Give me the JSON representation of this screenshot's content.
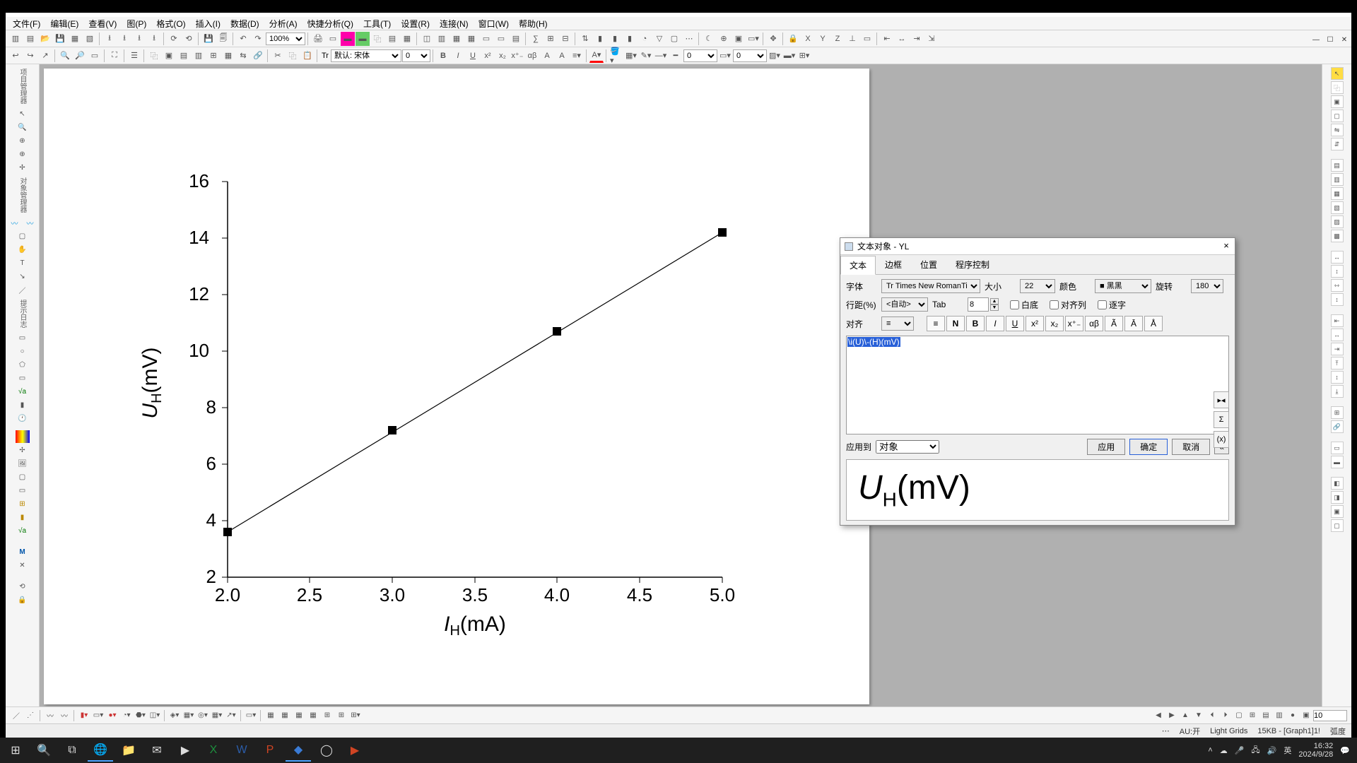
{
  "menu": [
    "文件(F)",
    "编辑(E)",
    "查看(V)",
    "图(P)",
    "格式(O)",
    "插入(I)",
    "数据(D)",
    "分析(A)",
    "快捷分析(Q)",
    "工具(T)",
    "设置(R)",
    "连接(N)",
    "窗口(W)",
    "帮助(H)"
  ],
  "toolbar1": {
    "zoom": "100%"
  },
  "toolbar2": {
    "font": "默认: 宋体",
    "size": "0",
    "size2": "0",
    "size3": "0"
  },
  "sheet_tab": "1",
  "chart_data": {
    "type": "scatter-line",
    "title": "",
    "xlabel": "I_H(mA)",
    "ylabel": "U_H(mV)",
    "xlim": [
      2.0,
      5.0
    ],
    "ylim": [
      2,
      16
    ],
    "xticks": [
      "2.0",
      "2.5",
      "3.0",
      "3.5",
      "4.0",
      "4.5",
      "5.0"
    ],
    "yticks": [
      "2",
      "4",
      "6",
      "8",
      "10",
      "12",
      "14",
      "16"
    ],
    "series": [
      {
        "name": "",
        "x": [
          2.0,
          3.0,
          4.0,
          5.0
        ],
        "y": [
          3.6,
          7.2,
          10.7,
          14.2
        ],
        "marker": "square",
        "line": true
      }
    ]
  },
  "dialog": {
    "title": "文本对象 - YL",
    "tabs": [
      "文本",
      "边框",
      "位置",
      "程序控制"
    ],
    "active_tab": 0,
    "font_label": "字体",
    "font_value": "Times New Roman",
    "size_label": "大小",
    "size_value": "22",
    "color_label": "颜色",
    "color_value": "黑",
    "rotate_label": "旋转",
    "rotate_value": "180",
    "linespace_label": "行距(%)",
    "linespace_value": "<自动>",
    "tab_label": "Tab",
    "tab_value": "8",
    "ck_white": "白底",
    "ck_aligncol": "对齐列",
    "ck_verbatim": "逐字",
    "align_label": "对齐",
    "text_content": "\\i(U)\\-(H)(mV)",
    "apply_to_label": "应用到",
    "apply_to_value": "对象",
    "btn_apply": "应用",
    "btn_ok": "确定",
    "btn_cancel": "取消",
    "preview_main": "U",
    "preview_sub": "H",
    "preview_tail": "(mV)"
  },
  "bottom_toolbar": {
    "value": "10"
  },
  "status": {
    "au": "AU:开",
    "theme": "Light Grids",
    "size": "15KB - [Graph1]1!",
    "mode": "弧度"
  },
  "taskbar": {
    "ime": "英",
    "time": "16:32",
    "date": "2024/9/28"
  }
}
